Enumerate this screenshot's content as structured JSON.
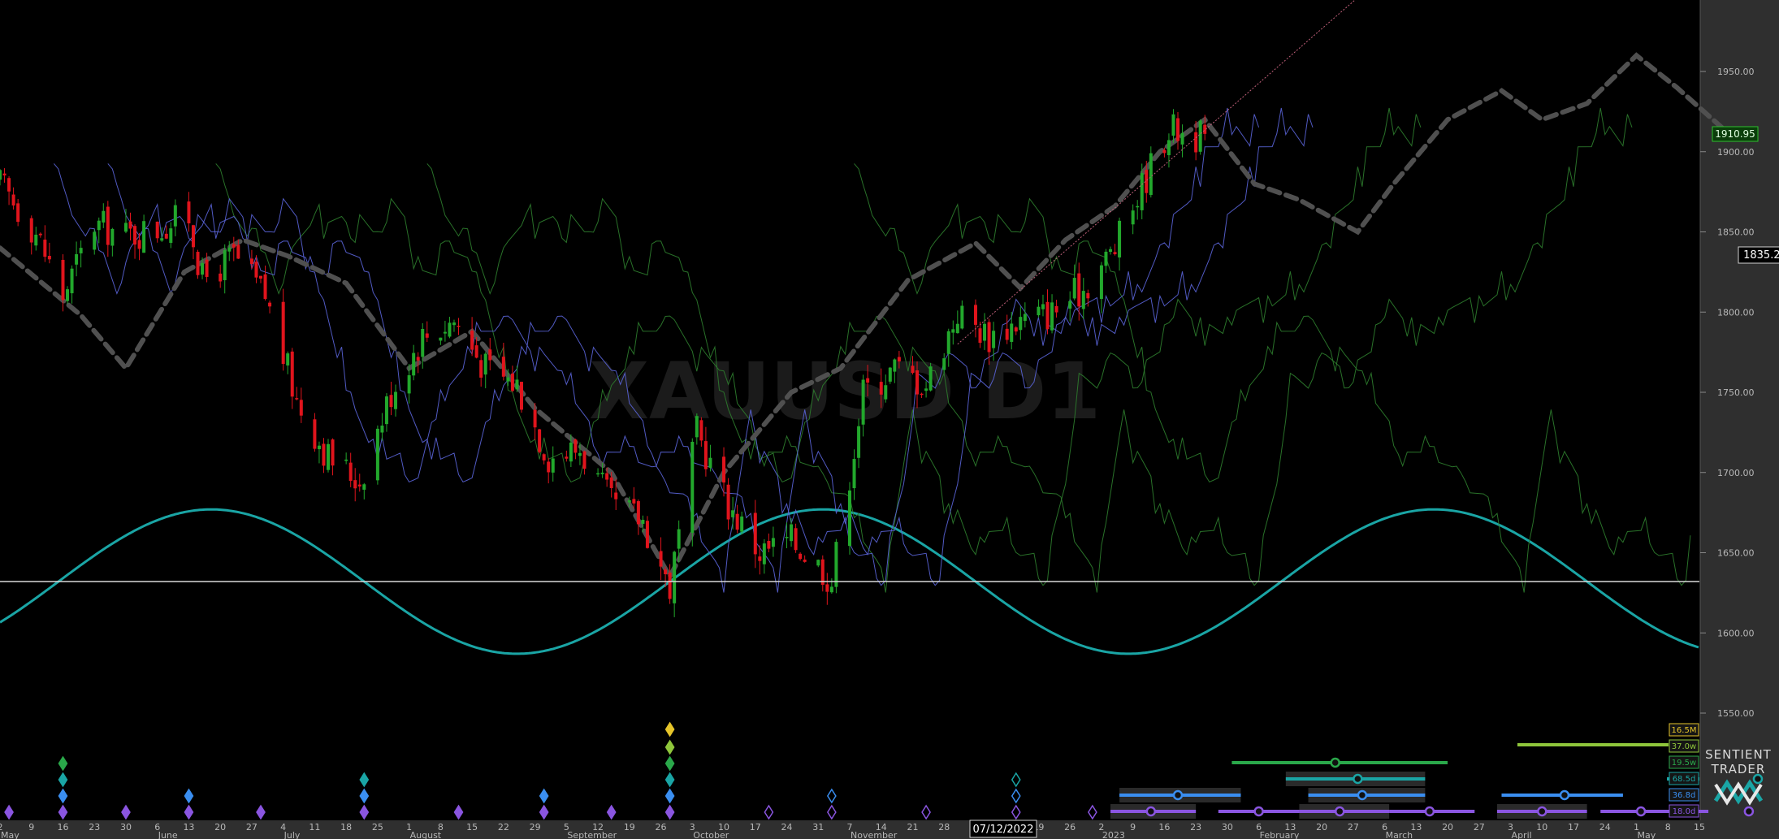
{
  "watermark": "XAUUSD D1",
  "price_labels": {
    "current": "1910.95",
    "crosshair": "1835.20"
  },
  "crosshair_date": "07/12/2022",
  "branding": {
    "line1": "SENTIENT",
    "line2": "TRADER"
  },
  "colors": {
    "up_candle": "#22a82c",
    "down_candle": "#e0141c",
    "sine": "#1aa5a5",
    "fld_green": "#2e7d2e",
    "fld_blue": "#5a64d8",
    "projection": "#505050",
    "level_line": "#d8d8d8",
    "trend_line": "#c0607a"
  },
  "legend": [
    {
      "label": "16.5M",
      "color": "#e6c52a"
    },
    {
      "label": "37.0w",
      "color": "#8fc63b"
    },
    {
      "label": "19.5w",
      "color": "#2aa84a"
    },
    {
      "label": "68.5d",
      "color": "#1aa5a5"
    },
    {
      "label": "36.8d",
      "color": "#3a8ef0"
    },
    {
      "label": "18.0d",
      "color": "#8a55e0"
    }
  ],
  "chart_data": {
    "type": "candlestick",
    "title": "XAUUSD D1",
    "y_range": [
      1520,
      2020
    ],
    "y_ticks": [
      1950,
      1900,
      1850,
      1800,
      1750,
      1700,
      1650,
      1600,
      1550
    ],
    "x_range": [
      "2022-05-02",
      "2023-05-15"
    ],
    "horizontal_level": 1632,
    "current_price": 1910.95,
    "crosshair_price": 1835.2,
    "crosshair_date": "2022-12-07",
    "x_tick_days": [
      "2",
      "9",
      "16",
      "23",
      "30",
      "6",
      "13",
      "20",
      "27",
      "4",
      "11",
      "18",
      "25",
      "1",
      "8",
      "15",
      "22",
      "29",
      "5",
      "12",
      "19",
      "26",
      "3",
      "10",
      "17",
      "24",
      "31",
      "7",
      "14",
      "21",
      "28",
      "5",
      "12",
      "19",
      "26",
      "2",
      "9",
      "16",
      "23",
      "30",
      "6",
      "13",
      "20",
      "27",
      "6",
      "13",
      "20",
      "27",
      "3",
      "10",
      "17",
      "24",
      "1",
      "8",
      "15"
    ],
    "months": [
      {
        "label": "May",
        "tick": 0
      },
      {
        "label": "June",
        "tick": 5
      },
      {
        "label": "July",
        "tick": 9
      },
      {
        "label": "August",
        "tick": 13
      },
      {
        "label": "September",
        "tick": 18
      },
      {
        "label": "October",
        "tick": 22
      },
      {
        "label": "November",
        "tick": 27
      },
      {
        "label": "2023",
        "tick": 35
      },
      {
        "label": "February",
        "tick": 40
      },
      {
        "label": "March",
        "tick": 44
      },
      {
        "label": "April",
        "tick": 48
      },
      {
        "label": "May",
        "tick": 52
      }
    ],
    "price_path": [
      [
        "2022-05-02",
        1880
      ],
      [
        "2022-05-10",
        1850
      ],
      [
        "2022-05-16",
        1810
      ],
      [
        "2022-05-23",
        1855
      ],
      [
        "2022-05-30",
        1848
      ],
      [
        "2022-06-06",
        1852
      ],
      [
        "2022-06-13",
        1860
      ],
      [
        "2022-06-16",
        1820
      ],
      [
        "2022-06-23",
        1835
      ],
      [
        "2022-06-30",
        1810
      ],
      [
        "2022-07-07",
        1745
      ],
      [
        "2022-07-14",
        1710
      ],
      [
        "2022-07-21",
        1695
      ],
      [
        "2022-07-28",
        1750
      ],
      [
        "2022-08-04",
        1785
      ],
      [
        "2022-08-11",
        1795
      ],
      [
        "2022-08-18",
        1765
      ],
      [
        "2022-08-25",
        1755
      ],
      [
        "2022-09-01",
        1710
      ],
      [
        "2022-09-08",
        1715
      ],
      [
        "2022-09-15",
        1680
      ],
      [
        "2022-09-22",
        1670
      ],
      [
        "2022-09-28",
        1628
      ],
      [
        "2022-10-04",
        1725
      ],
      [
        "2022-10-11",
        1680
      ],
      [
        "2022-10-18",
        1650
      ],
      [
        "2022-10-25",
        1658
      ],
      [
        "2022-11-01",
        1640
      ],
      [
        "2022-11-03",
        1632
      ],
      [
        "2022-11-10",
        1750
      ],
      [
        "2022-11-17",
        1765
      ],
      [
        "2022-11-24",
        1755
      ],
      [
        "2022-12-01",
        1800
      ],
      [
        "2022-12-08",
        1785
      ],
      [
        "2022-12-15",
        1795
      ],
      [
        "2022-12-22",
        1800
      ],
      [
        "2022-12-29",
        1815
      ],
      [
        "2023-01-05",
        1840
      ],
      [
        "2023-01-12",
        1885
      ],
      [
        "2023-01-17",
        1915
      ],
      [
        "2023-01-25",
        1908
      ]
    ],
    "sine_wave": {
      "amplitude": 45,
      "center": 1632,
      "first_peak": "2022-06-18",
      "period_days": 136
    },
    "projection_path": [
      [
        "2022-05-02",
        1840
      ],
      [
        "2022-05-20",
        1798
      ],
      [
        "2022-05-30",
        1765
      ],
      [
        "2022-06-12",
        1825
      ],
      [
        "2022-06-25",
        1845
      ],
      [
        "2022-07-05",
        1835
      ],
      [
        "2022-07-18",
        1818
      ],
      [
        "2022-08-01",
        1765
      ],
      [
        "2022-08-15",
        1788
      ],
      [
        "2022-08-29",
        1740
      ],
      [
        "2022-09-15",
        1700
      ],
      [
        "2022-09-28",
        1635
      ],
      [
        "2022-10-10",
        1700
      ],
      [
        "2022-10-25",
        1750
      ],
      [
        "2022-11-05",
        1765
      ],
      [
        "2022-11-20",
        1820
      ],
      [
        "2022-12-05",
        1843
      ],
      [
        "2022-12-15",
        1815
      ],
      [
        "2022-12-25",
        1845
      ],
      [
        "2023-01-05",
        1866
      ],
      [
        "2023-01-15",
        1900
      ],
      [
        "2023-01-25",
        1920
      ],
      [
        "2023-02-05",
        1880
      ],
      [
        "2023-02-15",
        1870
      ],
      [
        "2023-02-28",
        1850
      ],
      [
        "2023-03-08",
        1880
      ],
      [
        "2023-03-20",
        1920
      ],
      [
        "2023-04-01",
        1938
      ],
      [
        "2023-04-10",
        1920
      ],
      [
        "2023-04-20",
        1930
      ],
      [
        "2023-05-01",
        1960
      ],
      [
        "2023-05-10",
        1940
      ],
      [
        "2023-05-20",
        1915
      ]
    ]
  }
}
